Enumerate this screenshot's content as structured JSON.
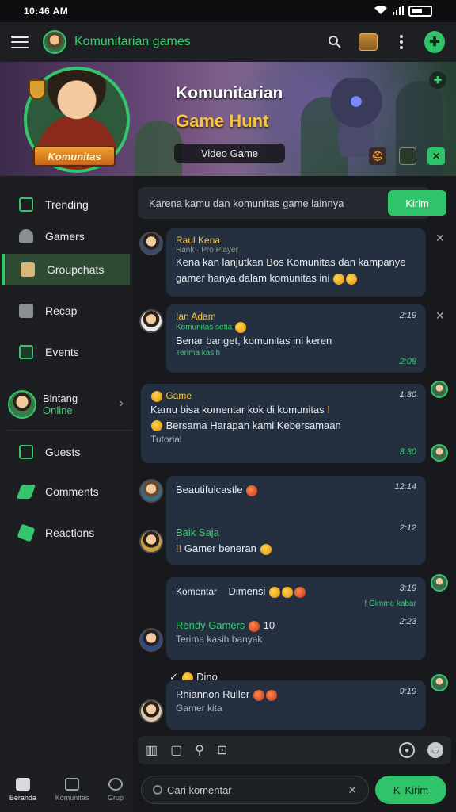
{
  "status": {
    "time": "10:46 AM"
  },
  "header": {
    "title": "Komunitarian games"
  },
  "banner": {
    "hero_label": "Komunitas",
    "title": "Komunitarian",
    "subtitle": "Game Hunt",
    "pill": "Video Game"
  },
  "sidebar": {
    "items": [
      {
        "label": "Trending",
        "icon": "home-icon"
      },
      {
        "label": "Gamers",
        "icon": "users-icon"
      },
      {
        "label": "Groupchats",
        "icon": "folder-icon"
      },
      {
        "label": "Recap",
        "icon": "lock-icon"
      },
      {
        "label": "Events",
        "icon": "calendar-icon"
      },
      {
        "label": "Guests",
        "icon": "card-icon"
      },
      {
        "label": "Comments",
        "icon": "pen-icon"
      },
      {
        "label": "Reactions",
        "icon": "tag-icon"
      }
    ],
    "profile": {
      "name": "Bintang",
      "status": "Online"
    }
  },
  "topic": {
    "text": "Karena kamu dan komunitas game lainnya",
    "button": "Kirim"
  },
  "messages": [
    {
      "name": "Raul Kena",
      "sub": "Rank · Pro Player",
      "body": "Kena kan lanjutkan Bos Komunitas dan kampanye gamer hanya dalam komunitas ini",
      "time": ""
    },
    {
      "name": "Ian Adam",
      "sub": "Komunitas setia",
      "body": "Benar banget, komunitas ini keren",
      "sub2": "Terima kasih",
      "time": "2:19",
      "time2": "2:08"
    },
    {
      "name": "Game",
      "body": "Kamu bisa komentar kok di komunitas",
      "body2": "Bersama Harapan kami Kebersamaan",
      "foot": "Tutorial",
      "time": "1:30",
      "time2": "3:30"
    },
    {
      "name": "Beautifulcastle",
      "time": "12:14",
      "name2": "Baik Saja",
      "body2": "Gamer beneran",
      "time2": "2:12"
    },
    {
      "quote": "Komentar",
      "name": "Dimensi",
      "sub": "Gimme kabar",
      "time": "3:19",
      "time2": "2:23",
      "name2": "Rendy Gamers",
      "num": "10",
      "body2": "Terima kasih banyak"
    },
    {
      "check": "Dino",
      "name": "Rhiannon Ruller",
      "body": "Gamer kita",
      "time": "9:19"
    }
  ],
  "bottom_nav": [
    {
      "label": "Beranda"
    },
    {
      "label": "Komunitas"
    },
    {
      "label": "Grup"
    }
  ],
  "composer": {
    "placeholder": "Cari komentar",
    "send": "Kirim"
  }
}
